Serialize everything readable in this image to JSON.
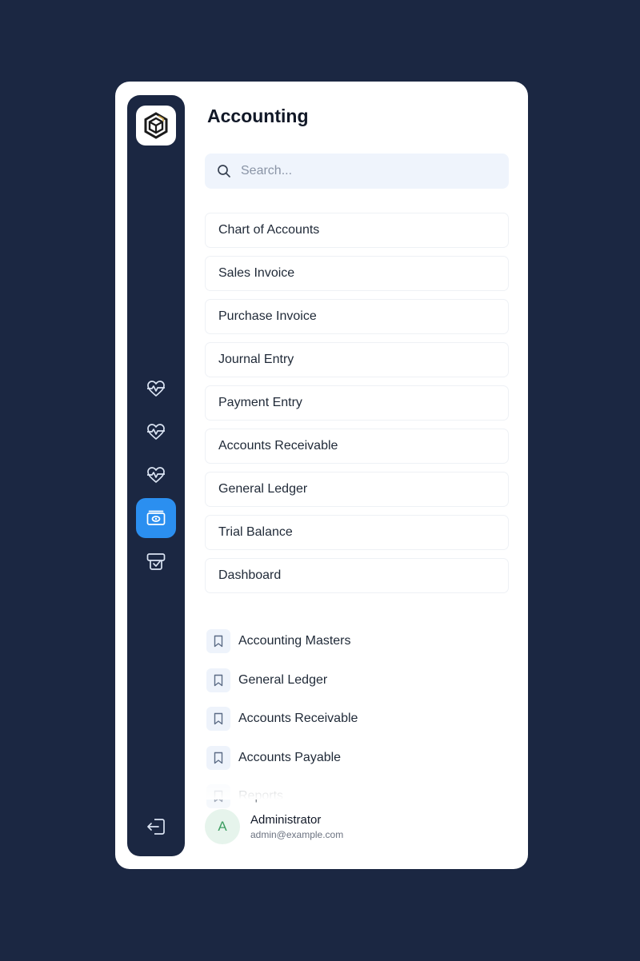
{
  "colors": {
    "background": "#1b2742",
    "rail": "#1b2742",
    "accent": "#2b8ff0",
    "avatar_bg": "#e6f4ec",
    "avatar_text": "#3e9e62"
  },
  "rail": {
    "logo_icon": "cube-logo-icon",
    "buttons": [
      {
        "icon": "heartbeat-icon",
        "active": false
      },
      {
        "icon": "heartbeat-icon",
        "active": false
      },
      {
        "icon": "heartbeat-icon",
        "active": false
      },
      {
        "icon": "money-icon",
        "active": true
      },
      {
        "icon": "receipt-icon",
        "active": false
      }
    ],
    "logout_icon": "logout-icon"
  },
  "panel": {
    "title": "Accounting",
    "search": {
      "placeholder": "Search...",
      "value": ""
    },
    "menu_items": [
      "Chart of Accounts",
      "Sales Invoice",
      "Purchase Invoice",
      "Journal Entry",
      "Payment Entry",
      "Accounts Receivable",
      "General Ledger",
      "Trial Balance",
      "Dashboard"
    ],
    "bookmarks": [
      "Accounting Masters",
      "General Ledger",
      "Accounts Receivable",
      "Accounts Payable",
      "Reports"
    ]
  },
  "user": {
    "initial": "A",
    "name": "Administrator",
    "email": "admin@example.com"
  }
}
